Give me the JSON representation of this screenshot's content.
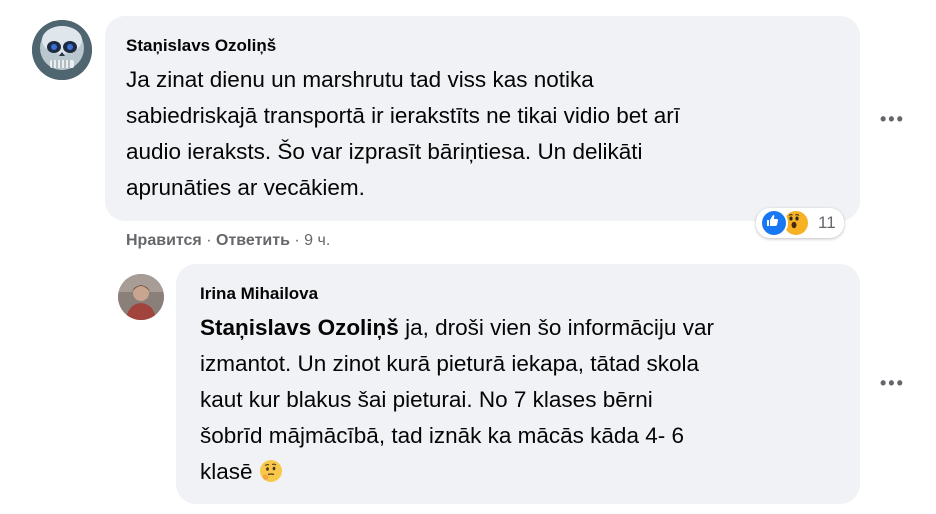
{
  "comment": {
    "author": "Staņislavs Ozoliņš",
    "lines": [
      "Ja zinat dienu un marshrutu tad viss kas notika",
      "sabiedriskajā transportā ir ierakstīts ne tikai vidio bet arī",
      "audio ieraksts. Šo var izprasīt bāriņtiesa. Un delikāti",
      "aprunāties ar vecākiem."
    ],
    "more_label": "•••",
    "like_action": "Нравится",
    "separator": "·",
    "reply_action": "Ответить",
    "time": "9 ч.",
    "reaction_count": "11",
    "reaction_icons": [
      "like-icon",
      "wow-icon"
    ]
  },
  "reply": {
    "author": "Irina Mihailova",
    "mention": "Staņislavs Ozoliņš",
    "lines": [
      " ja, droši vien šo informāciju var",
      "izmantot. Un zinot kurā pieturā iekapa, tātad skola",
      "kaut kur blakus šai pieturai. No 7 klases bērni",
      "šobrīd mājmācībā, tad iznāk ka mācās kāda 4- 6",
      "klasē "
    ],
    "emoji_icon": "thinking-face-icon",
    "more_label": "•••"
  },
  "colors": {
    "bubble": "#f0f2f5",
    "secondary_text": "#65676b",
    "like_blue": "#1877f2",
    "wow_yellow": "#f7b125"
  }
}
